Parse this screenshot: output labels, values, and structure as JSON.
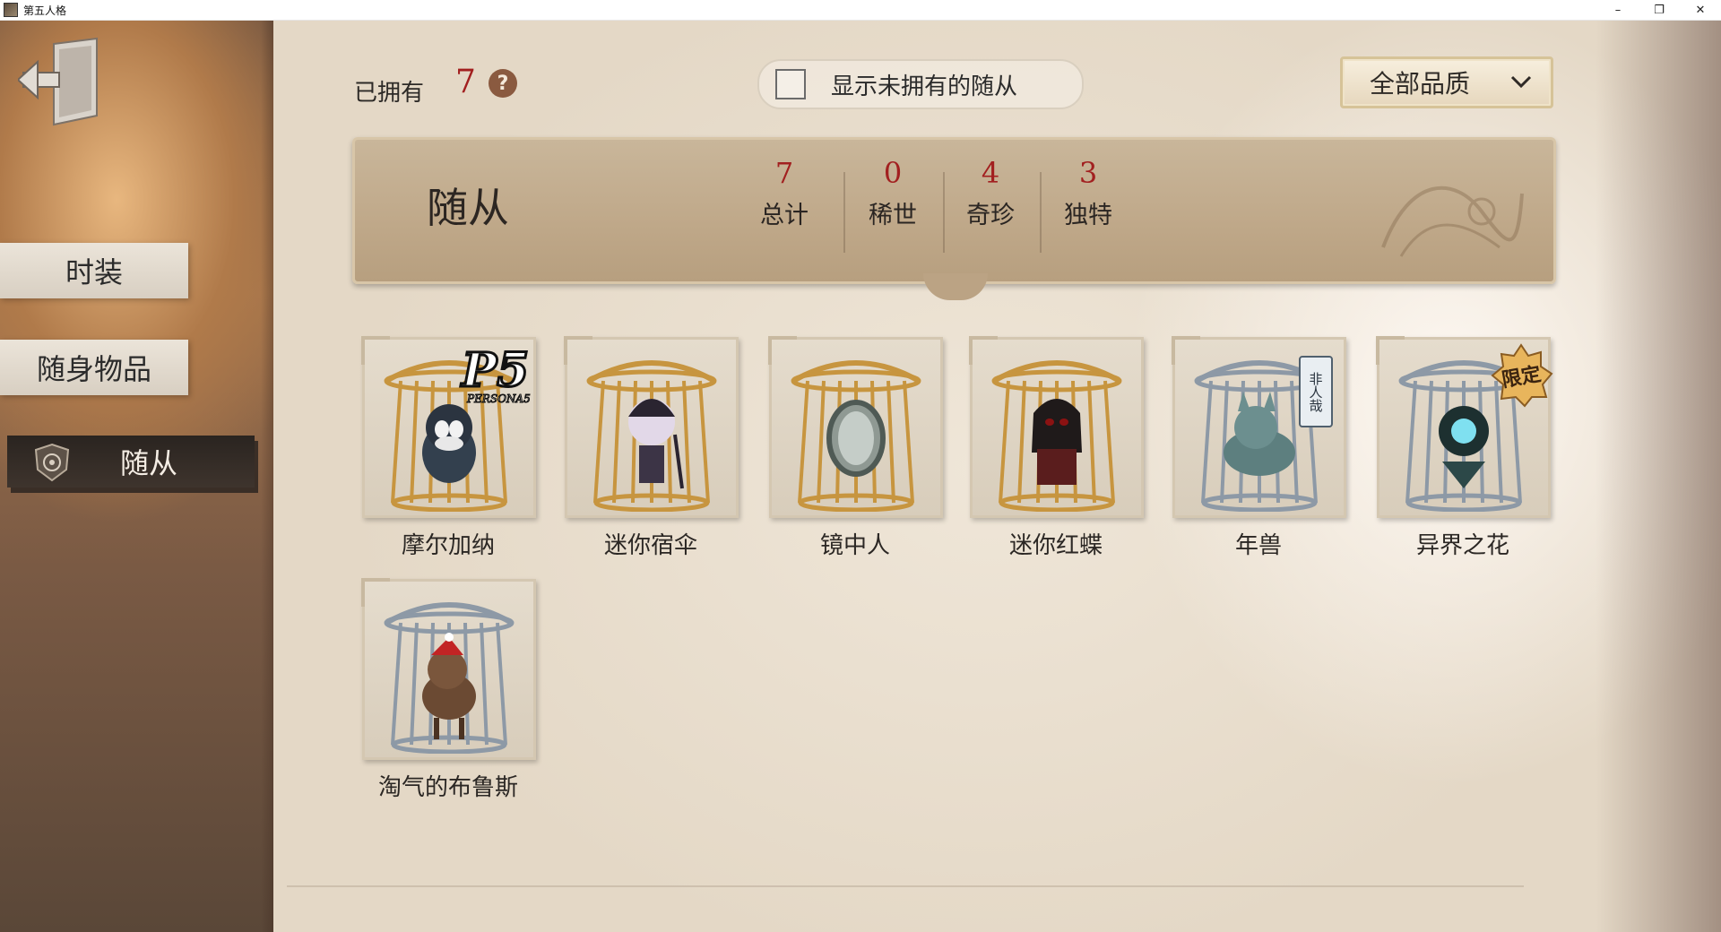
{
  "window": {
    "title": "第五人格",
    "minimize_label": "–",
    "restore_label": "❐",
    "close_label": "✕"
  },
  "sidebar": {
    "exit_icon": "exit-door-icon",
    "tabs": [
      {
        "label": "时装",
        "active": false
      },
      {
        "label": "随身物品",
        "active": false
      },
      {
        "label": "随从",
        "active": true,
        "icon": "companion-emblem-icon"
      }
    ]
  },
  "header": {
    "owned_label": "已拥有",
    "owned_count": "7",
    "help_label": "?",
    "show_unowned_label": "显示未拥有的随从",
    "show_unowned_checked": false,
    "quality_filter": "全部品质"
  },
  "banner": {
    "title": "随从",
    "stats": [
      {
        "value": "7",
        "label": "总计"
      },
      {
        "value": "0",
        "label": "稀世"
      },
      {
        "value": "4",
        "label": "奇珍"
      },
      {
        "value": "3",
        "label": "独特"
      }
    ]
  },
  "companions": [
    {
      "name": "摩尔加纳",
      "cage": "gold",
      "badge": "P5",
      "badge_sub": "PERSONA5"
    },
    {
      "name": "迷你宿伞",
      "cage": "gold"
    },
    {
      "name": "镜中人",
      "cage": "gold"
    },
    {
      "name": "迷你红蝶",
      "cage": "gold"
    },
    {
      "name": "年兽",
      "cage": "silver",
      "badge": "非人哉"
    },
    {
      "name": "异界之花",
      "cage": "silver",
      "badge": "限定"
    },
    {
      "name": "淘气的布鲁斯",
      "cage": "silver"
    }
  ],
  "colors": {
    "accent_red": "#a21f1f",
    "gold_cage": "#c7953f",
    "silver_cage": "#8d99a6"
  }
}
